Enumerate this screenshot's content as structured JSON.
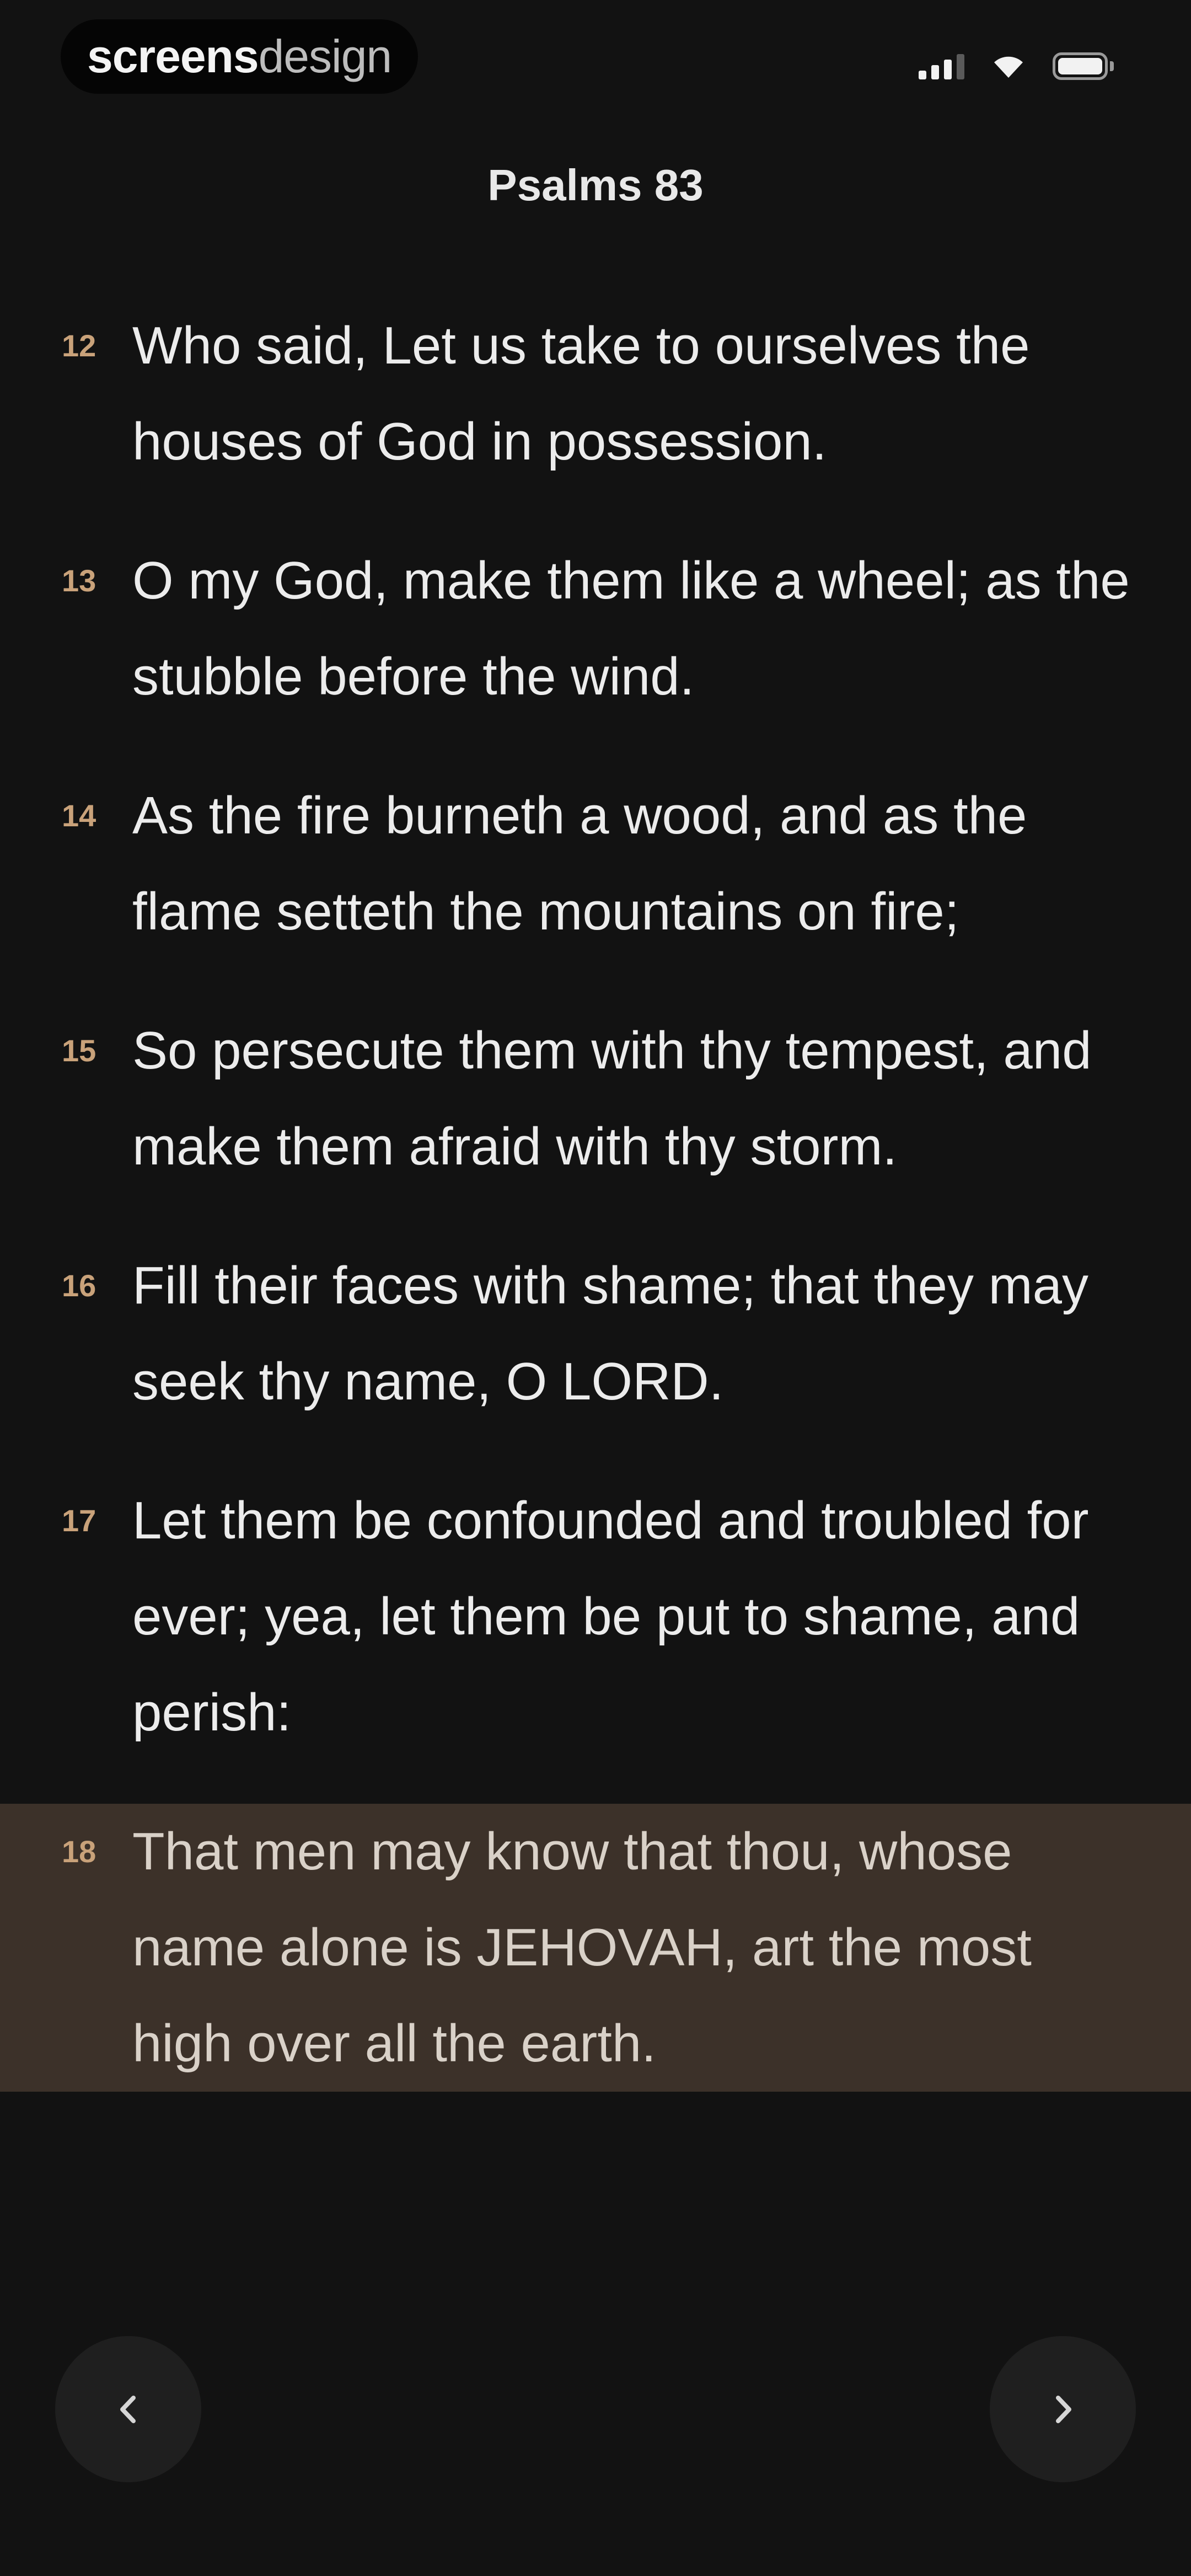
{
  "status_bar": {
    "brand_bold": "screens",
    "brand_light": "design",
    "icons": [
      "signal-icon",
      "wifi-icon",
      "battery-icon"
    ]
  },
  "header": {
    "title": "Psalms 83"
  },
  "verses": [
    {
      "number": "12",
      "text": "Who said, Let us take to ourselves the houses of God in possession.",
      "highlighted": false
    },
    {
      "number": "13",
      "text": "O my God, make them like a wheel; as the stubble before the wind.",
      "highlighted": false
    },
    {
      "number": "14",
      "text": "As the fire burneth a wood, and as the flame setteth the mountains on fire;",
      "highlighted": false
    },
    {
      "number": "15",
      "text": "So persecute them with thy tempest, and make them afraid with thy storm.",
      "highlighted": false
    },
    {
      "number": "16",
      "text": "Fill their faces with shame; that they may seek thy name, O LORD.",
      "highlighted": false
    },
    {
      "number": "17",
      "text": "Let them be confounded and troubled for ever; yea, let them be put to shame, and perish:",
      "highlighted": false
    },
    {
      "number": "18",
      "text": "That men may know that thou, whose name alone is JEHOVAH, art the most high over all the earth.",
      "highlighted": true
    }
  ],
  "navigation": {
    "prev_icon": "chevron-left-icon",
    "next_icon": "chevron-right-icon"
  },
  "colors": {
    "background": "#121212",
    "verse_number": "#C9A27A",
    "highlight": "#3C3129",
    "nav_button": "#1F1F1F"
  }
}
